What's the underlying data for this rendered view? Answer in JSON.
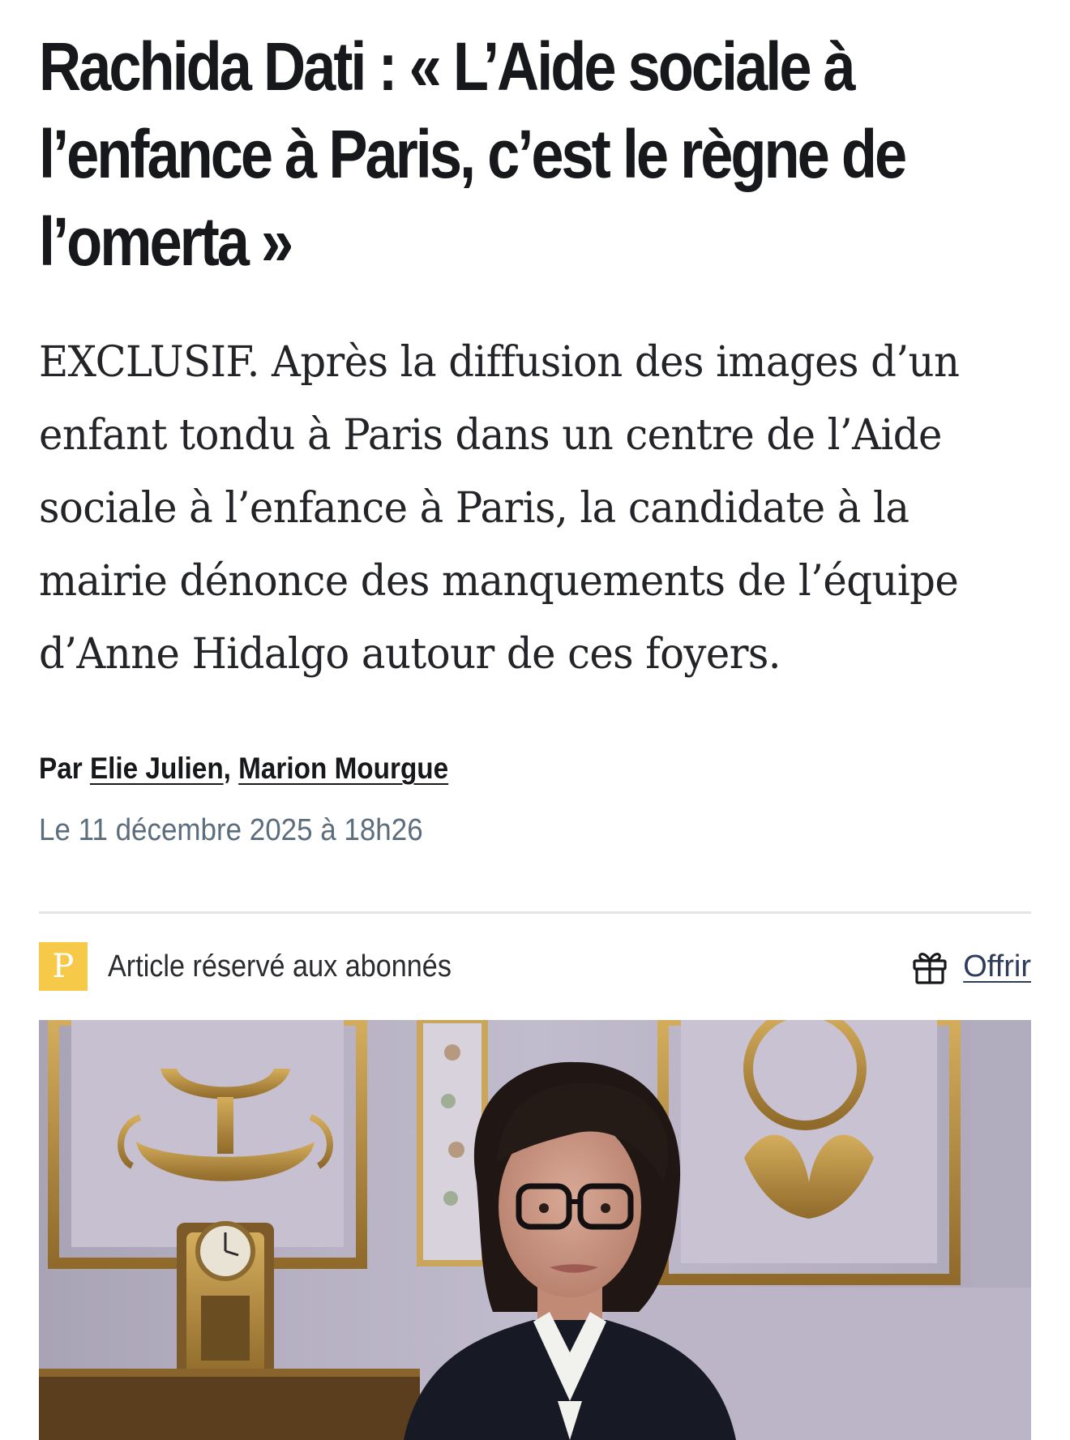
{
  "article": {
    "title": "Rachida Dati : « L’Aide sociale à l’enfance à Paris, c’est le règne de l’omerta »",
    "lede": "EXCLUSIF. Après la diffusion des images d’un enfant tondu à Paris dans un centre de l’Aide sociale à l’enfance à Paris, la candidate à la mairie dénonce des manquements de l’équipe d’Anne Hidalgo autour de ces foyers.",
    "byline": {
      "prefix": "Par",
      "authors": [
        "Elie Julien",
        "Marion Mourgue"
      ],
      "separator": ","
    },
    "date": "Le 11 décembre 2025 à 18h26"
  },
  "premium": {
    "badge_letter": "P",
    "label": "Article réservé aux abonnés",
    "offer_label": "Offrir",
    "offer_icon": "gift-icon",
    "badge_color": "#f7c948"
  },
  "photo": {
    "subject": "portrait-photo",
    "palette": {
      "wall": "#b8b2c6",
      "gold": "#b98d3a",
      "hair": "#201714",
      "jacket": "#171a24",
      "shirt": "#f1f1ee"
    }
  }
}
